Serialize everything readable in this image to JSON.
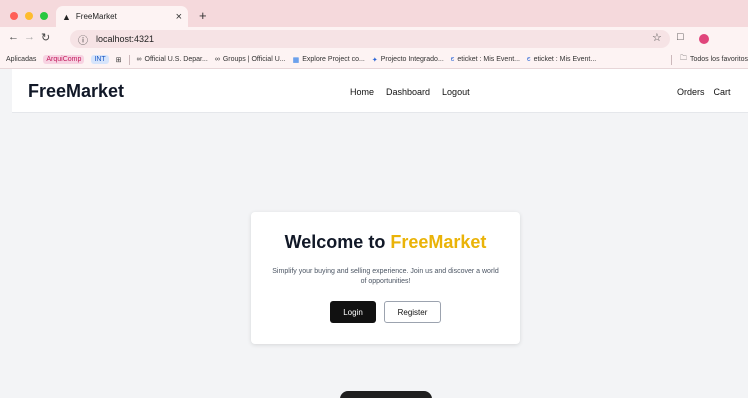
{
  "browser": {
    "tab": {
      "title": "FreeMarket",
      "favicon": "flame-icon"
    },
    "url": "localhost:4321",
    "bookmarks": [
      {
        "label": "Aplicadas",
        "style": "plain"
      },
      {
        "label": "ArquiComp",
        "style": "pink"
      },
      {
        "label": "INT",
        "style": "blue"
      },
      {
        "label": "Official U.S. Depar...",
        "icon": "link-icon"
      },
      {
        "label": "Groups | Official U...",
        "icon": "link-icon"
      },
      {
        "label": "Explore Project co...",
        "icon": "grid-icon"
      },
      {
        "label": "Projecto Integrado...",
        "icon": "pin-icon"
      },
      {
        "label": "eticket : Mis Event...",
        "icon": "e-icon"
      },
      {
        "label": "eticket : Mis Event...",
        "icon": "e-icon"
      }
    ],
    "bookmarks_folder": "Todos los favoritos"
  },
  "nav": {
    "brand": "FreeMarket",
    "center_links": [
      "Home",
      "Dashboard",
      "Logout"
    ],
    "right_links": [
      "Orders",
      "Cart"
    ]
  },
  "card": {
    "title_prefix": "Welcome to ",
    "title_highlight": "FreeMarket",
    "subtitle": "Simplify your buying and selling experience. Join us and discover a world of opportunities!",
    "login_label": "Login",
    "register_label": "Register"
  },
  "colors": {
    "accent": "#eab308",
    "primary_button": "#111111"
  }
}
